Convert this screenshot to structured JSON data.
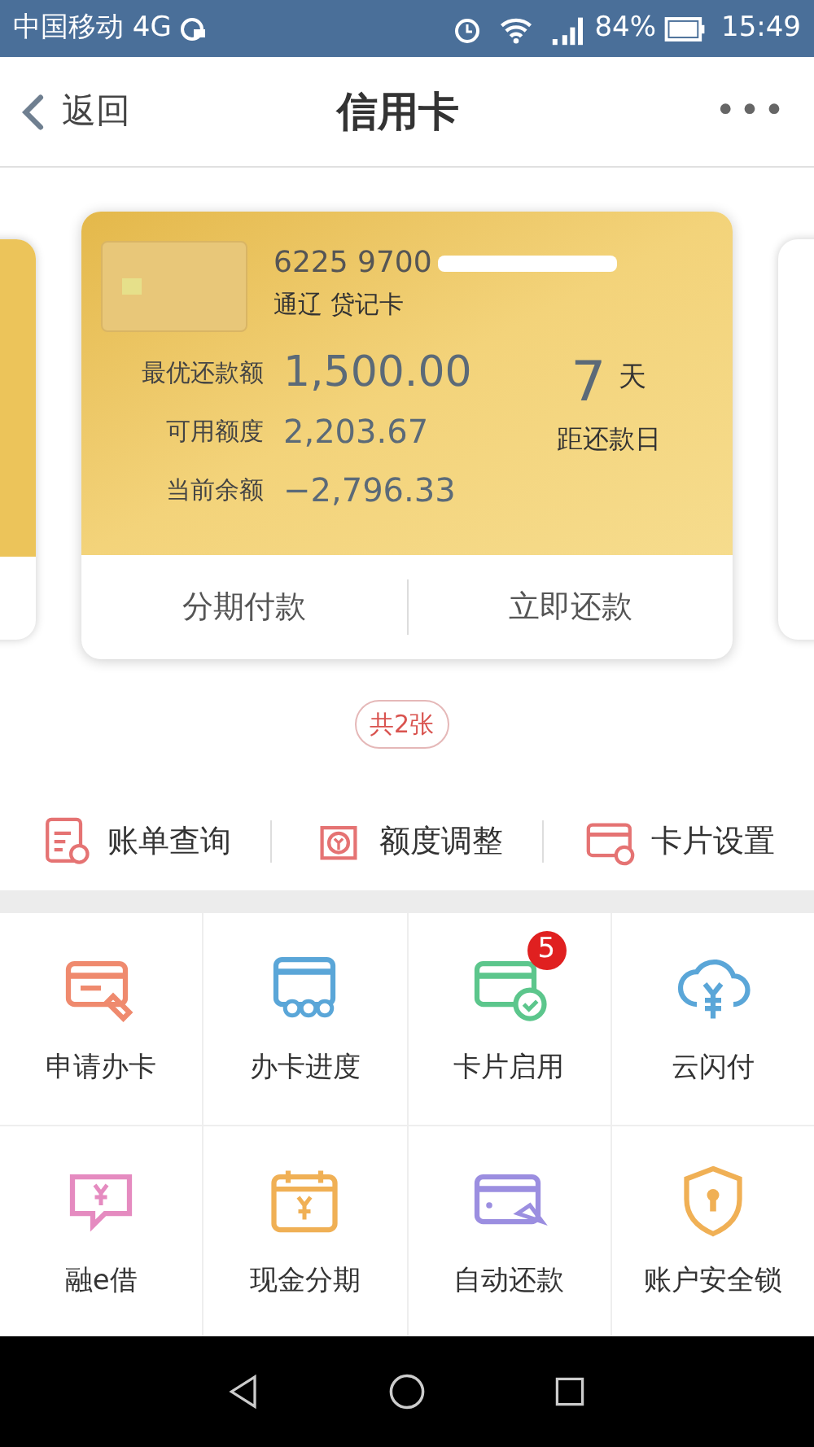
{
  "status_bar": {
    "carrier": "中国移动 4G",
    "battery": "84%",
    "time": "15:49"
  },
  "header": {
    "back": "返回",
    "title": "信用卡",
    "more": "•••"
  },
  "card": {
    "number": "6225 9700",
    "name": "通辽 贷记卡",
    "rows": [
      {
        "label": "最优还款额",
        "value": "1,500.00"
      },
      {
        "label": "可用额度",
        "value": "2,203.67"
      },
      {
        "label": "当前余额",
        "value": "−2,796.33"
      }
    ],
    "days": "7",
    "days_unit": "天",
    "days_label": "距还款日",
    "actions": [
      "分期付款",
      "立即还款"
    ]
  },
  "card_count": "共2张",
  "quick_actions": [
    "账单查询",
    "额度调整",
    "卡片设置"
  ],
  "grid": [
    {
      "label": "申请办卡"
    },
    {
      "label": "办卡进度"
    },
    {
      "label": "卡片启用",
      "badge": "5"
    },
    {
      "label": "云闪付"
    },
    {
      "label": "融e借"
    },
    {
      "label": "现金分期"
    },
    {
      "label": "自动还款"
    },
    {
      "label": "账户安全锁"
    }
  ]
}
